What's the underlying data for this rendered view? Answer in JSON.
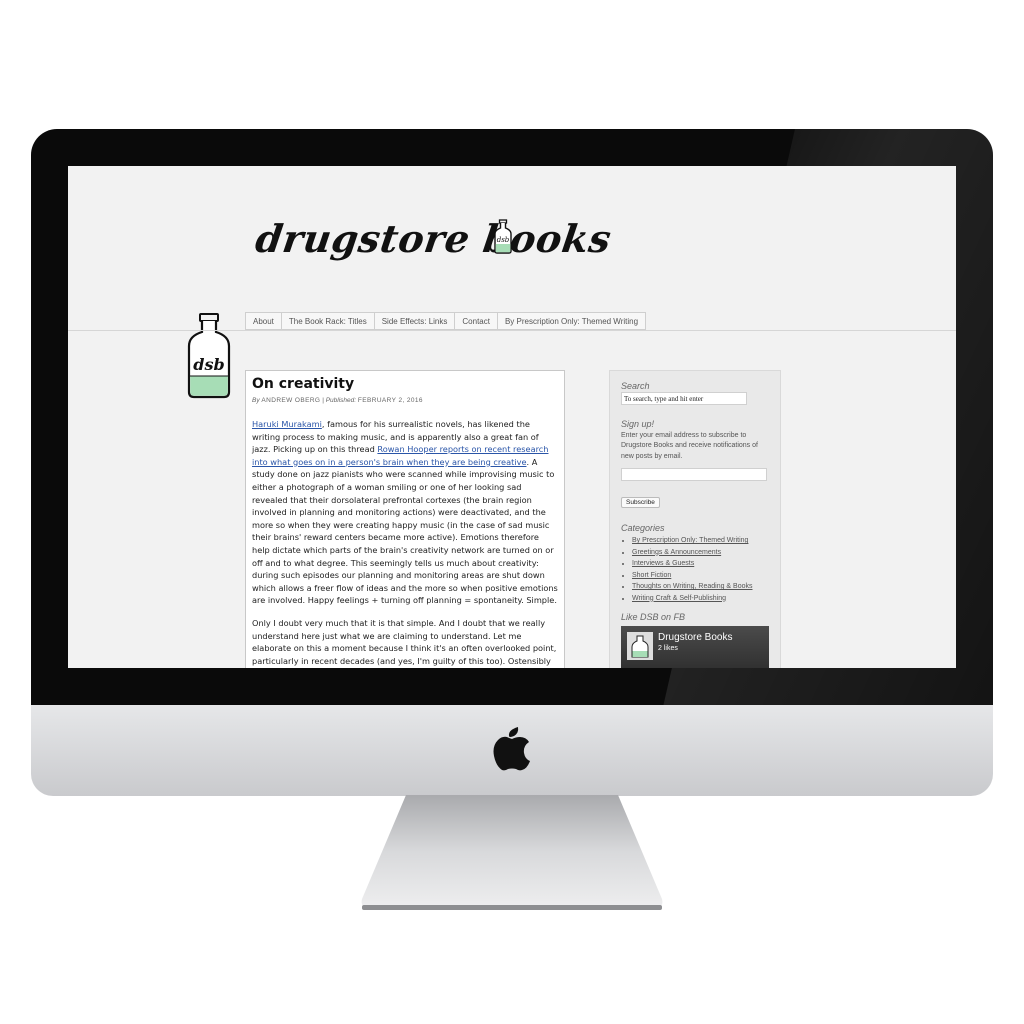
{
  "site": {
    "name": "drugstore books",
    "logo_label": "dsb",
    "accent_color": "#a7ddb6"
  },
  "nav": {
    "items": [
      {
        "label": "About"
      },
      {
        "label": "The Book Rack: Titles"
      },
      {
        "label": "Side Effects: Links"
      },
      {
        "label": "Contact"
      },
      {
        "label": "By Prescription Only: Themed Writing"
      }
    ]
  },
  "post": {
    "title": "On creativity",
    "by_label": "By",
    "author": "ANDREW OBERG",
    "separator": "|",
    "published_label": "Published:",
    "date": "FEBRUARY 2, 2016",
    "p1": {
      "link1": "Haruki Murakami",
      "text1": ", famous for his surrealistic novels, has likened the writing process to making music, and is apparently also a great fan of jazz. Picking up on this thread ",
      "link2": "Rowan Hooper reports on recent research into what goes on in a person's brain when they are being creative",
      "text2": ". A study done on jazz pianists who were scanned while improvising music to either a photograph of a woman smiling or one of her looking sad revealed that their dorsolateral prefrontal cortexes (the brain region involved in planning and monitoring actions) were deactivated, and the more so when they were creating happy music (in the case of sad music their brains' reward centers became more active). Emotions therefore help dictate which parts of the brain's creativity network are turned on or off and to what degree. This seemingly tells us much about creativity: during such episodes our planning and monitoring areas are shut down which allows a freer flow of ideas and the more so when positive emotions are involved. Happy feelings + turning off planning = spontaneity. Simple."
    },
    "p2": "Only I doubt very much that it is that simple. And I doubt that we really understand here just what we are claiming to understand. Let me elaborate on this a moment because I think it's an often overlooked point, particularly in recent decades (and yes, I'm guilty of this too). Ostensibly"
  },
  "sidebar": {
    "search_title": "Search",
    "search_placeholder": "To search, type and hit enter",
    "signup_title": "Sign up!",
    "signup_text": "Enter your email address to subscribe to Drugstore Books and receive notifications of new posts by email.",
    "subscribe_label": "Subscribe",
    "categories_title": "Categories",
    "categories": [
      {
        "label": "By Prescription Only: Themed Writing"
      },
      {
        "label": "Greetings & Announcements"
      },
      {
        "label": "Interviews & Guests"
      },
      {
        "label": "Short Fiction"
      },
      {
        "label": "Thoughts on Writing, Reading & Books"
      },
      {
        "label": "Writing Craft & Self-Publishing"
      }
    ],
    "fb_title": "Like DSB on FB",
    "fb_page_name": "Drugstore Books",
    "fb_likes": "2 likes"
  }
}
